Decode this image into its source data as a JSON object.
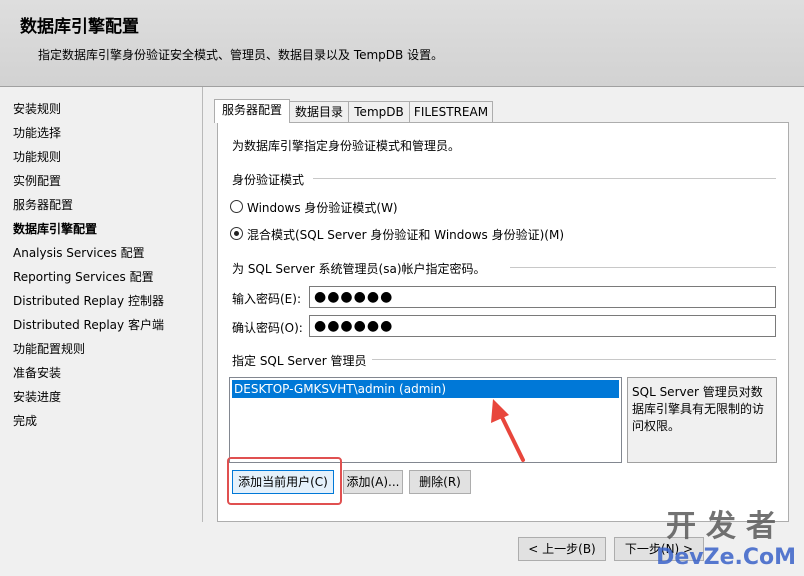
{
  "header": {
    "title": "数据库引擎配置",
    "subtitle": "指定数据库引擎身份验证安全模式、管理员、数据目录以及 TempDB 设置。"
  },
  "sidebar": {
    "items": [
      {
        "label": "安装规则"
      },
      {
        "label": "功能选择"
      },
      {
        "label": "功能规则"
      },
      {
        "label": "实例配置"
      },
      {
        "label": "服务器配置"
      },
      {
        "label": "数据库引擎配置"
      },
      {
        "label": "Analysis Services 配置"
      },
      {
        "label": "Reporting Services 配置"
      },
      {
        "label": "Distributed Replay 控制器"
      },
      {
        "label": "Distributed Replay 客户端"
      },
      {
        "label": "功能配置规则"
      },
      {
        "label": "准备安装"
      },
      {
        "label": "安装进度"
      },
      {
        "label": "完成"
      }
    ]
  },
  "tabs": [
    {
      "label": "服务器配置"
    },
    {
      "label": "数据目录"
    },
    {
      "label": "TempDB"
    },
    {
      "label": "FILESTREAM"
    }
  ],
  "panel": {
    "intro": "为数据库引擎指定身份验证模式和管理员。",
    "auth_group": "身份验证模式",
    "radio_windows": "Windows 身份验证模式(W)",
    "radio_mixed": "混合模式(SQL Server 身份验证和 Windows 身份验证)(M)",
    "sa_group": "为 SQL Server 系统管理员(sa)帐户指定密码。",
    "password_label": "输入密码(E):",
    "password_value": "●●●●●●",
    "confirm_label": "确认密码(O):",
    "confirm_value": "●●●●●●",
    "admin_group": "指定 SQL Server 管理员",
    "admin_entry": "DESKTOP-GMKSVHT\\admin (admin)",
    "admin_info": "SQL Server 管理员对数据库引擎具有无限制的访问权限。",
    "btn_add_current": "添加当前用户(C)",
    "btn_add": "添加(A)...",
    "btn_remove": "删除(R)"
  },
  "footer": {
    "btn_back": "< 上一步(B)",
    "btn_next": "下一步(N) >"
  },
  "watermark": {
    "line1": "开发者",
    "line2": "DevZe.CoM"
  },
  "colors": {
    "selection": "#0078d7",
    "highlight_box": "#e05050",
    "arrow": "#e8463c"
  }
}
